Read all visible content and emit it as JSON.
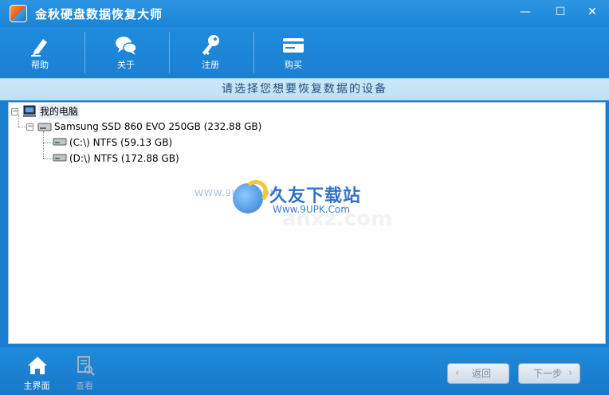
{
  "window": {
    "title": "金秋硬盘数据恢复大师",
    "controls": {
      "minimize": "—",
      "maximize": "☐",
      "close": "✕"
    }
  },
  "toolbar": {
    "items": [
      {
        "label": "帮助",
        "icon": "pen-icon"
      },
      {
        "label": "关于",
        "icon": "chat-bubbles-icon"
      },
      {
        "label": "注册",
        "icon": "key-icon"
      },
      {
        "label": "购买",
        "icon": "card-icon"
      }
    ]
  },
  "main": {
    "heading": "请选择您想要恢复数据的设备"
  },
  "tree": {
    "root": {
      "label": "我的电脑",
      "expander": "−"
    },
    "disk": {
      "label": "Samsung SSD 860 EVO 250GB (232.88 GB)",
      "expander": "−"
    },
    "partitions": [
      {
        "label": "(C:\\) NTFS (59.13 GB)"
      },
      {
        "label": "(D:\\) NTFS (172.88 GB)"
      }
    ]
  },
  "watermark": {
    "site_name": "久友下载站",
    "url": "Www.9UPK.Com",
    "left_text": "WWW.9UPK.COM",
    "ghost_text": "anxz.com"
  },
  "footer": {
    "items": [
      {
        "label": "主界面",
        "icon": "home-icon",
        "enabled": true
      },
      {
        "label": "查看",
        "icon": "view-document-icon",
        "enabled": false
      }
    ],
    "back_button": "返回",
    "next_button": "下一步"
  },
  "colors": {
    "primary_blue": "#1a7fd0",
    "header_light_blue": "#c6e3f5",
    "disabled_text": "#9fb3c9"
  }
}
